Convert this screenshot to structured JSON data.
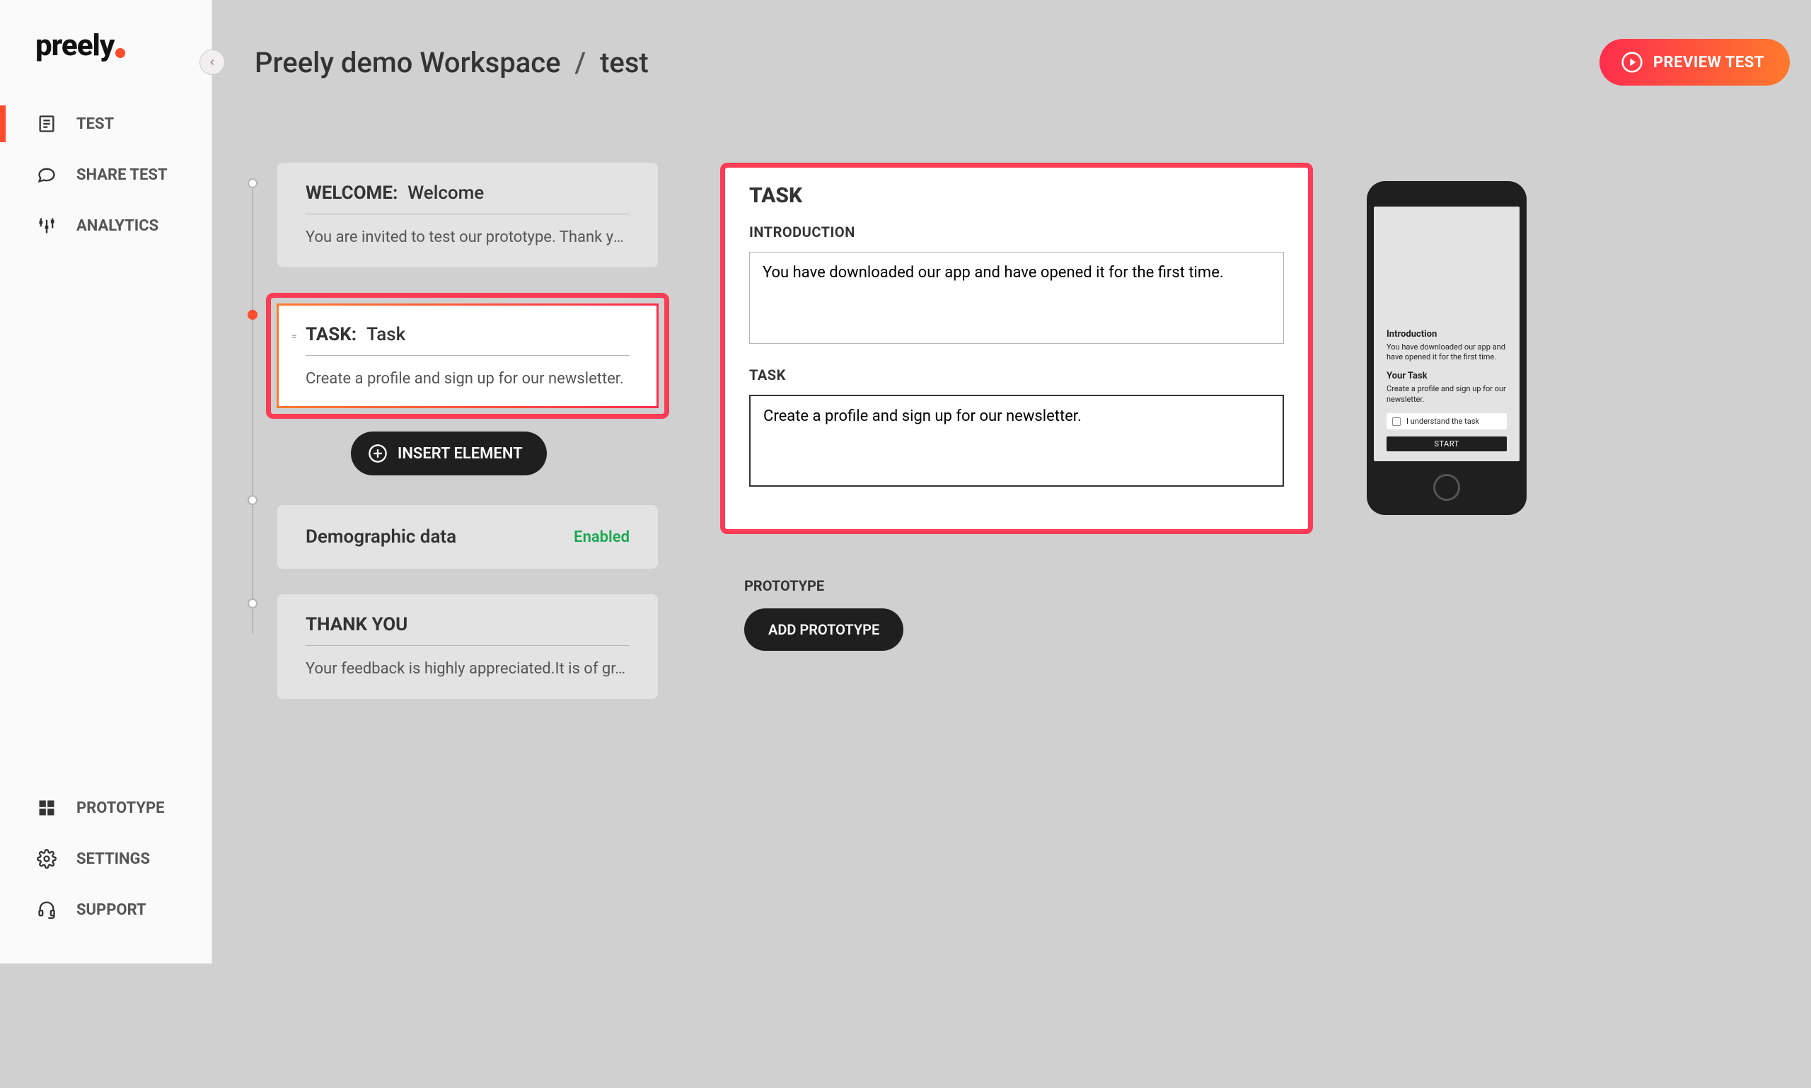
{
  "brand": "preely",
  "sidebar": {
    "test": "TEST",
    "share": "SHARE TEST",
    "analytics": "ANALYTICS",
    "prototype": "PROTOTYPE",
    "settings": "SETTINGS",
    "support": "SUPPORT"
  },
  "breadcrumb": {
    "workspace": "Preely demo Workspace",
    "sep": "/",
    "current": "test"
  },
  "preview_button": "PREVIEW TEST",
  "flow": {
    "welcome": {
      "type": "WELCOME:",
      "name": "Welcome",
      "sub": "You are invited to test our prototype. Thank yo…"
    },
    "task": {
      "type": "TASK:",
      "name": "Task",
      "sub": "Create a profile and sign up for our newsletter."
    },
    "insert_label": "INSERT ELEMENT",
    "demographic": {
      "type": "Demographic data",
      "status": "Enabled"
    },
    "thankyou": {
      "type": "THANK YOU",
      "sub": "Your feedback is highly appreciated.It is of gr…"
    }
  },
  "editor": {
    "heading": "TASK",
    "intro_label": "INTRODUCTION",
    "intro_value": "You have downloaded our app and have opened it for the first time.",
    "task_label": "TASK",
    "task_value": "Create a profile and sign up for our newsletter.",
    "prototype_label": "PROTOTYPE",
    "add_prototype": "ADD PROTOTYPE"
  },
  "phone": {
    "intro_h": "Introduction",
    "intro_p": "You have downloaded our app and have opened it for the first time.",
    "task_h": "Your Task",
    "task_p": "Create a profile and sign up for our newsletter.",
    "understand": "I understand the task",
    "start": "START"
  }
}
